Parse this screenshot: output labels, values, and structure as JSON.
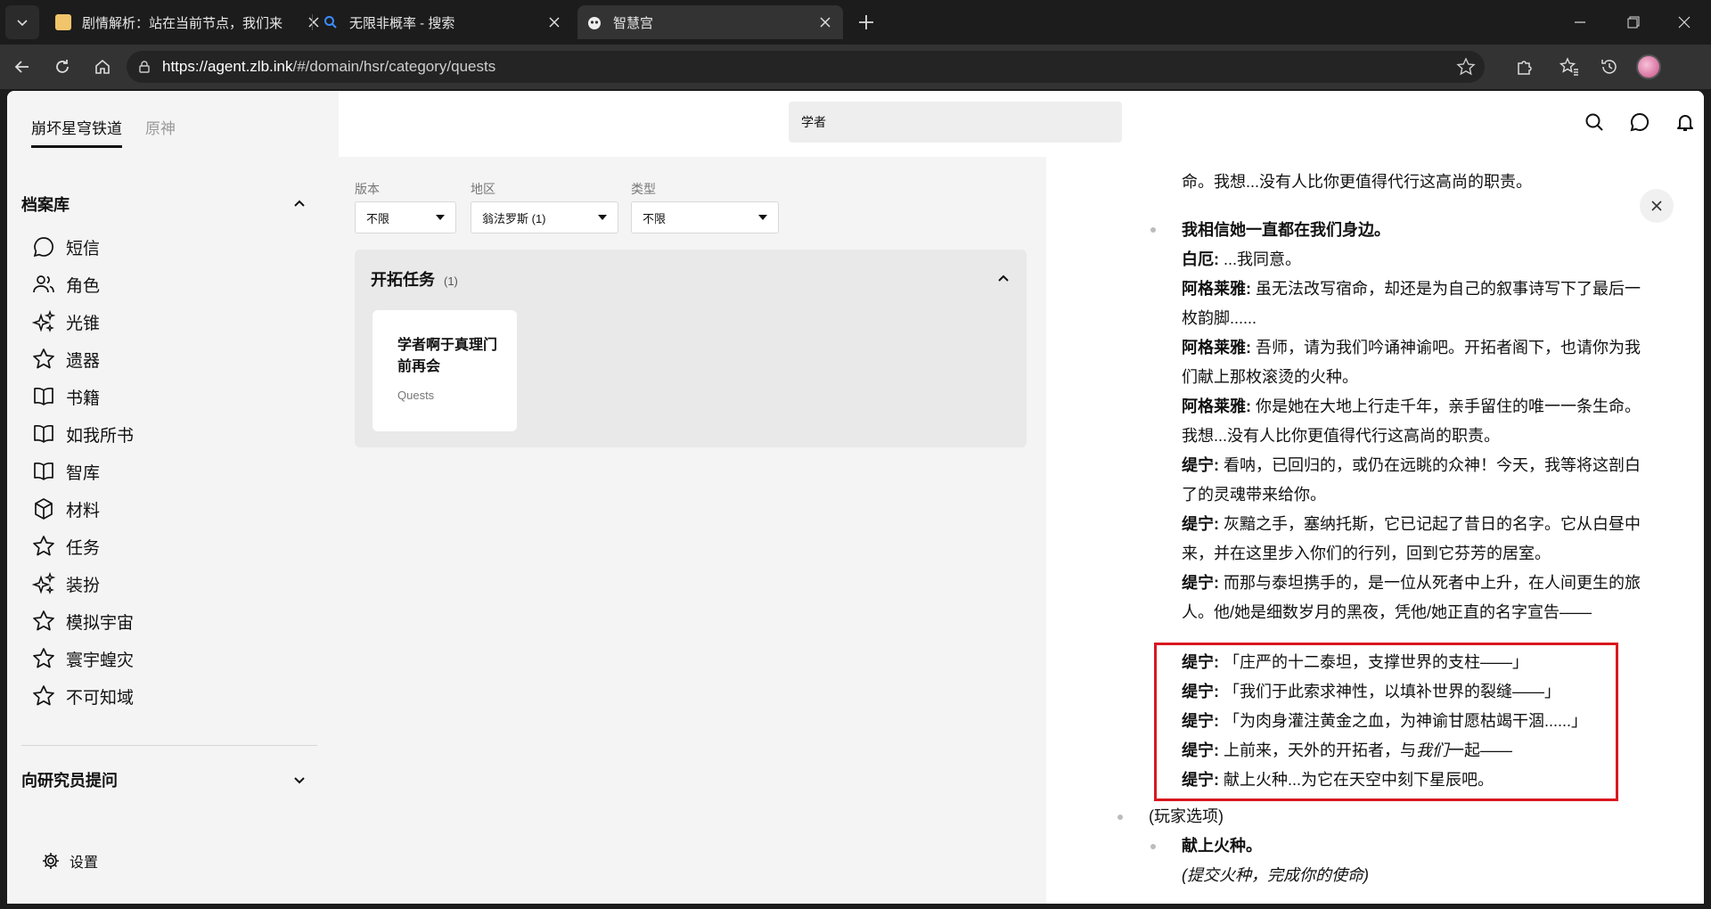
{
  "browser": {
    "tabs": [
      {
        "title": "剧情解析：站在当前节点，我们来"
      },
      {
        "title": "无限非概率 - 搜索"
      },
      {
        "title": "智慧宫"
      }
    ],
    "url_host": "https://agent.zlb.ink",
    "url_path": "/#/domain/hsr/category/quests"
  },
  "sidebar": {
    "game_tabs": [
      "崩坏星穹铁道",
      "原神"
    ],
    "archive_heading": "档案库",
    "items": [
      {
        "label": "短信",
        "icon": "message-bubble-icon"
      },
      {
        "label": "角色",
        "icon": "users-icon"
      },
      {
        "label": "光锥",
        "icon": "sparkles-icon"
      },
      {
        "label": "遗器",
        "icon": "star-icon"
      },
      {
        "label": "书籍",
        "icon": "book-open-icon"
      },
      {
        "label": "如我所书",
        "icon": "book-open-icon"
      },
      {
        "label": "智库",
        "icon": "book-open-icon"
      },
      {
        "label": "材料",
        "icon": "cube-icon"
      },
      {
        "label": "任务",
        "icon": "star-icon"
      },
      {
        "label": "装扮",
        "icon": "sparkles-icon"
      },
      {
        "label": "模拟宇宙",
        "icon": "star-icon"
      },
      {
        "label": "寰宇蝗灾",
        "icon": "star-icon"
      },
      {
        "label": "不可知域",
        "icon": "star-icon"
      }
    ],
    "ask_heading": "向研究员提问",
    "settings_label": "设置"
  },
  "search": {
    "value": "学者"
  },
  "filters": [
    {
      "label": "版本",
      "value": "不限"
    },
    {
      "label": "地区",
      "value": "翁法罗斯 (1)"
    },
    {
      "label": "类型",
      "value": "不限"
    }
  ],
  "panel": {
    "title": "开拓任务",
    "count": "(1)",
    "card": {
      "title": "学者啊于真理门前再会",
      "type": "Quests"
    }
  },
  "detail": {
    "lines": [
      {
        "speaker": "",
        "text": "命。我想...没有人比你更值得代行这高尚的职责。"
      },
      {
        "speaker": "",
        "text": "我相信她一直都在我们身边。",
        "bold": true
      },
      {
        "speaker": "白厄:",
        "text": " ...我同意。"
      },
      {
        "speaker": "阿格莱雅:",
        "text": " 虽无法改写宿命，却还是为自己的叙事诗写下了最后一枚韵脚......"
      },
      {
        "speaker": "阿格莱雅:",
        "text": " 吾师，请为我们吟诵神谕吧。开拓者阁下，也请你为我们献上那枚滚烫的火种。"
      },
      {
        "speaker": "阿格莱雅:",
        "text": " 你是她在大地上行走千年，亲手留住的唯一一条生命。我想...没有人比你更值得代行这高尚的职责。"
      },
      {
        "speaker": "缇宁:",
        "text": " 看呐，已回归的，或仍在远眺的众神！今天，我等将这剖白了的灵魂带来给你。"
      },
      {
        "speaker": "缇宁:",
        "text": " 灰黯之手，塞纳托斯，它已记起了昔日的名字。它从白昼中来，并在这里步入你们的行列，回到它芬芳的居室。"
      },
      {
        "speaker": "缇宁:",
        "text": " 而那与泰坦携手的，是一位从死者中上升，在人间更生的旅人。他/她是细数岁月的黑夜，凭他/她正直的名字宣告——"
      },
      {
        "speaker": "缇宁:",
        "text": " 「庄严的十二泰坦，支撑世界的支柱——」"
      },
      {
        "speaker": "缇宁:",
        "text": " 「我们于此索求神性，以填补世界的裂缝——」"
      },
      {
        "speaker": "缇宁:",
        "text": " 「为肉身灌注黄金之血，为神谕甘愿枯竭干涸......」"
      },
      {
        "speaker": "缇宁:",
        "text": " 上前来，天外的开拓者，与",
        "italic": "我们",
        "after": "一起——"
      },
      {
        "speaker": "缇宁:",
        "text": " 献上火种...为它在天空中刻下星辰吧。"
      },
      {
        "speaker": "",
        "text": "(玩家选项)"
      },
      {
        "speaker": "",
        "text": "献上火种。",
        "bold": true
      },
      {
        "speaker": "",
        "text": "(提交火种，完成你的使命)",
        "italic_line": true
      }
    ]
  }
}
